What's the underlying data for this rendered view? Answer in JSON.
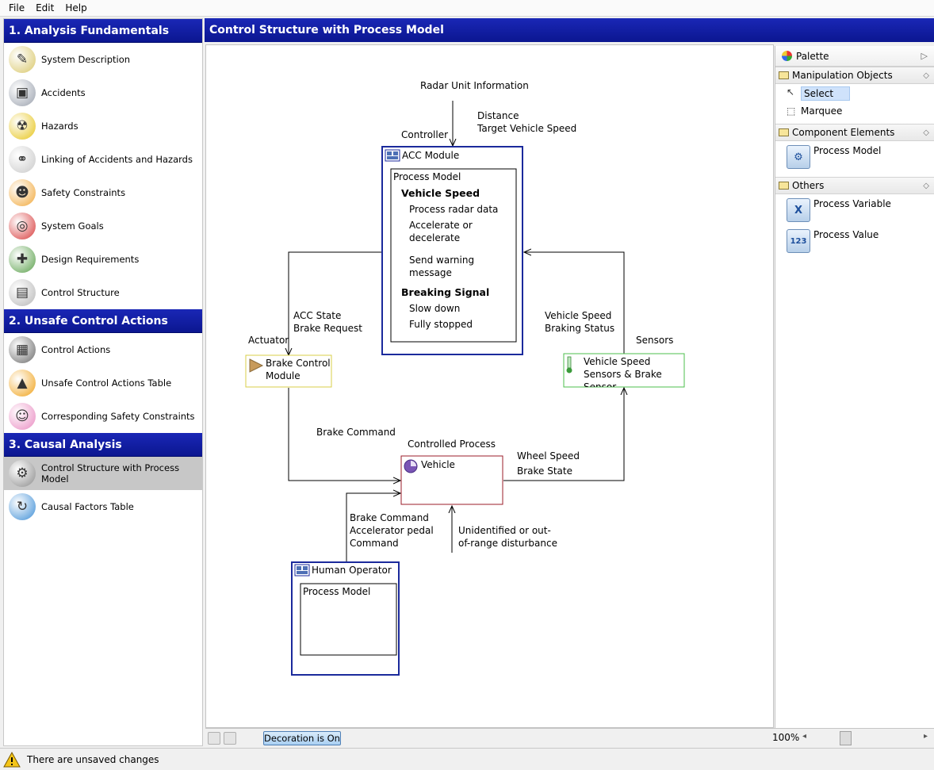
{
  "menu": [
    "File",
    "Edit",
    "Help"
  ],
  "sidebar": {
    "sections": [
      {
        "title": "1. Analysis Fundamentals",
        "items": [
          {
            "label": "System Description",
            "icon": "pencil-paper-icon",
            "color": "#d9c76a",
            "glyph": "✎"
          },
          {
            "label": "Accidents",
            "icon": "building-explosion-icon",
            "color": "#9aa1ad",
            "glyph": "▣"
          },
          {
            "label": "Hazards",
            "icon": "radiation-icon",
            "color": "#e6c41a",
            "glyph": "☢"
          },
          {
            "label": "Linking of Accidents and Hazards",
            "icon": "link-icon",
            "color": "#c9c9c9",
            "glyph": "⚭"
          },
          {
            "label": "Safety Constraints",
            "icon": "worker-icon",
            "color": "#f1a83b",
            "glyph": "☻"
          },
          {
            "label": "System Goals",
            "icon": "target-icon",
            "color": "#d73b3b",
            "glyph": "◎"
          },
          {
            "label": "Design Requirements",
            "icon": "puzzle-icon",
            "color": "#5aa04b",
            "glyph": "✚"
          },
          {
            "label": "Control Structure",
            "icon": "blueprint-icon",
            "color": "#b8b8b8",
            "glyph": "▤"
          }
        ]
      },
      {
        "title": "2. Unsafe Control Actions",
        "items": [
          {
            "label": "Control Actions",
            "icon": "monitor-icon",
            "color": "#6b6b6b",
            "glyph": "▦"
          },
          {
            "label": "Unsafe Control Actions Table",
            "icon": "warning-light-icon",
            "color": "#f0a21a",
            "glyph": "▲"
          },
          {
            "label": "Corresponding Safety Constraints",
            "icon": "people-icon",
            "color": "#e98bc1",
            "glyph": "☺"
          }
        ]
      },
      {
        "title": "3. Causal Analysis",
        "items": [
          {
            "label": "Control Structure with Process Model",
            "icon": "gear-icon",
            "color": "#8b8b8b",
            "glyph": "⚙",
            "active": true
          },
          {
            "label": "Causal Factors Table",
            "icon": "cycle-icon",
            "color": "#3e8ed6",
            "glyph": "↻"
          }
        ]
      }
    ]
  },
  "editor": {
    "title": "Control Structure with Process Model"
  },
  "diagram": {
    "radar_label": "Radar Unit Information",
    "distance_label": "Distance",
    "target_speed_label": "Target Vehicle Speed",
    "controller_label": "Controller",
    "acc_module": "ACC Module",
    "process_model": "Process Model",
    "vehicle_speed": "Vehicle Speed",
    "process_radar": "Process radar data",
    "accelerate_1": "Accelerate or",
    "accelerate_2": "decelerate",
    "warning_1": "Send warning",
    "warning_2": "message",
    "breaking_signal": "Breaking Signal",
    "slow_down": "Slow down",
    "fully_stopped": "Fully stopped",
    "acc_state": "ACC State",
    "brake_request": "Brake Request",
    "vs_feedback": "Vehicle Speed",
    "braking_status": "Braking Status",
    "actuator_label": "Actuator",
    "sensors_label": "Sensors",
    "brake_module_1": "Brake Control",
    "brake_module_2": "Module",
    "sensor_box_1": "Vehicle Speed",
    "sensor_box_2": "Sensors & Brake",
    "sensor_box_3": "Sensor",
    "brake_command": "Brake Command",
    "controlled_process_label": "Controlled Process",
    "vehicle": "Vehicle",
    "wheel_speed": "Wheel Speed",
    "brake_state": "Brake State",
    "ho_cmd_1": "Brake Command",
    "ho_cmd_2": "Accelerator pedal",
    "ho_cmd_3": "Command",
    "disturb_1": "Unidentified or out-",
    "disturb_2": "of-range disturbance",
    "human_operator": "Human Operator",
    "ho_process_model": "Process Model"
  },
  "palette": {
    "title": "Palette",
    "groups": [
      {
        "title": "Manipulation Objects",
        "entries": [
          {
            "label": "Select",
            "icon": "arrow-cursor-icon",
            "selected": true
          },
          {
            "label": "Marquee",
            "icon": "marquee-icon"
          }
        ]
      },
      {
        "title": "Component Elements",
        "entries": [
          {
            "label": "Process Model",
            "icon": "process-model-icon",
            "big": true,
            "glyph": "⚙"
          }
        ]
      },
      {
        "title": "Others",
        "entries": [
          {
            "label": "Process Variable",
            "icon": "process-variable-icon",
            "big": true,
            "glyph": "X"
          },
          {
            "label": "Process Value",
            "icon": "process-value-icon",
            "big": true,
            "glyph": "123"
          }
        ]
      }
    ]
  },
  "bottom": {
    "decoration": "Decoration is On",
    "zoom": "100%"
  },
  "status": {
    "message": "There are unsaved changes"
  },
  "colors": {
    "header_blue": "#0b1690",
    "controller_border": "#1b2a9c",
    "actuator_border": "#d8cf4a",
    "sensor_border": "#4cbf4c",
    "process_border": "#9b1d2a"
  }
}
